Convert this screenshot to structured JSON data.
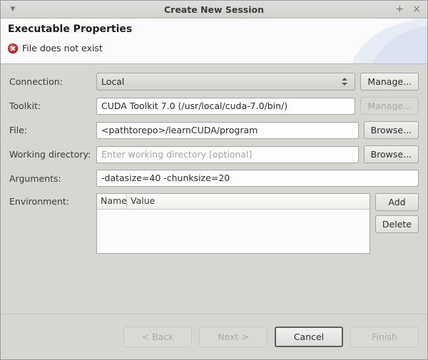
{
  "titlebar": {
    "title": "Create New Session",
    "menu_icon": "chevron-down-icon",
    "maximize_label": "+",
    "close_label": "×"
  },
  "banner": {
    "title": "Executable Properties",
    "error_icon": "error-circle-icon",
    "error_message": "File does not exist"
  },
  "form": {
    "connection": {
      "label": "Connection:",
      "value": "Local",
      "button_label": "Manage...",
      "button_enabled": true
    },
    "toolkit": {
      "label": "Toolkit:",
      "value": "CUDA Toolkit 7.0 (/usr/local/cuda-7.0/bin/)",
      "button_label": "Manage...",
      "button_enabled": false
    },
    "file": {
      "label": "File:",
      "value": "<pathtorepo>/learnCUDA/program",
      "button_label": "Browse...",
      "button_enabled": true
    },
    "working_directory": {
      "label": "Working directory:",
      "value": "",
      "placeholder": "Enter working directory [optional]",
      "button_label": "Browse...",
      "button_enabled": true
    },
    "arguments": {
      "label": "Arguments:",
      "value": "-datasize=40 -chunksize=20"
    },
    "environment": {
      "label": "Environment:",
      "columns": [
        "Name",
        "Value"
      ],
      "rows": [],
      "add_label": "Add",
      "delete_label": "Delete"
    }
  },
  "footer": {
    "back_label": "< Back",
    "back_enabled": false,
    "next_label": "Next >",
    "next_enabled": false,
    "cancel_label": "Cancel",
    "cancel_enabled": true,
    "finish_label": "Finish",
    "finish_enabled": false
  },
  "colors": {
    "window_bg": "#d6d6d3",
    "banner_bg": "#fbfbfb",
    "error_red": "#d62020",
    "accent_blue": "#dbe2f2"
  }
}
